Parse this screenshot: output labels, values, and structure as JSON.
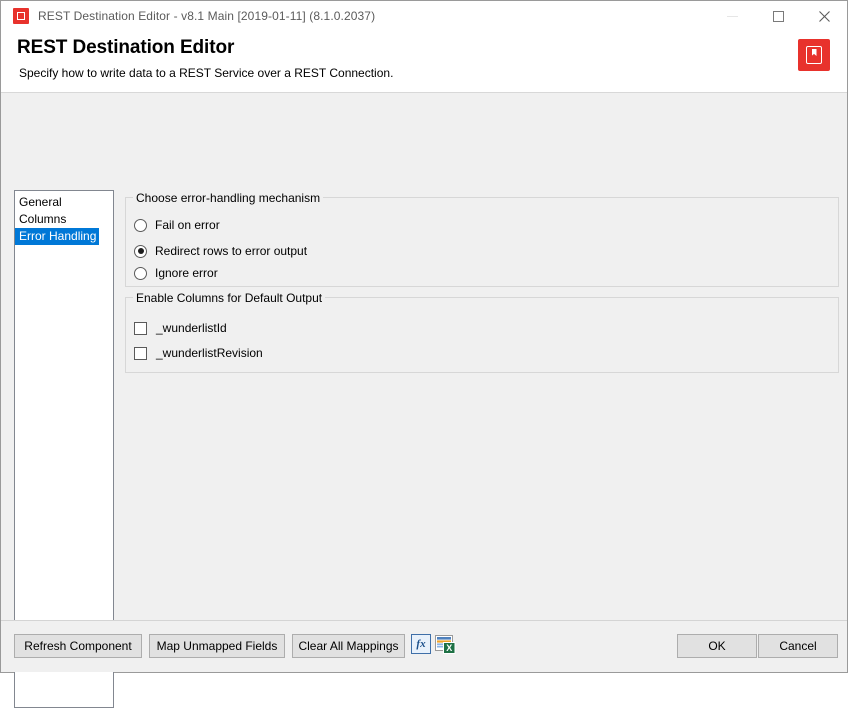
{
  "window": {
    "title": "REST Destination Editor - v8.1 Main [2019-01-11] (8.1.0.2037)",
    "app_icon": "rest-destination-icon",
    "controls": {
      "minimize": "minimize-icon",
      "maximize": "maximize-icon",
      "close": "close-icon"
    }
  },
  "header": {
    "title": "REST Destination Editor",
    "subtitle": "Specify how to write data to a REST Service over a REST Connection.",
    "logo": "help-book-icon",
    "logo_color": "#e8322c"
  },
  "sidebar": {
    "items": [
      {
        "label": "General",
        "selected": false
      },
      {
        "label": "Columns",
        "selected": false
      },
      {
        "label": "Error Handling",
        "selected": true
      }
    ],
    "selection_color": "#0078d7"
  },
  "main": {
    "error_group": {
      "title": "Choose error-handling mechanism",
      "options": [
        {
          "label": "Fail on error",
          "checked": false
        },
        {
          "label": "Redirect rows to error output",
          "checked": true
        },
        {
          "label": "Ignore error",
          "checked": false
        }
      ]
    },
    "columns_group": {
      "title": "Enable Columns for Default Output",
      "checkboxes": [
        {
          "label": "_wunderlistId",
          "checked": false
        },
        {
          "label": "_wunderlistRevision",
          "checked": false
        }
      ]
    }
  },
  "footer": {
    "refresh_label": "Refresh Component",
    "map_label": "Map Unmapped Fields",
    "clear_label": "Clear All Mappings",
    "fx_label": "fx",
    "fx_icon": "expression-fx-icon",
    "export_icon": "export-to-excel-icon",
    "ok_label": "OK",
    "cancel_label": "Cancel"
  }
}
